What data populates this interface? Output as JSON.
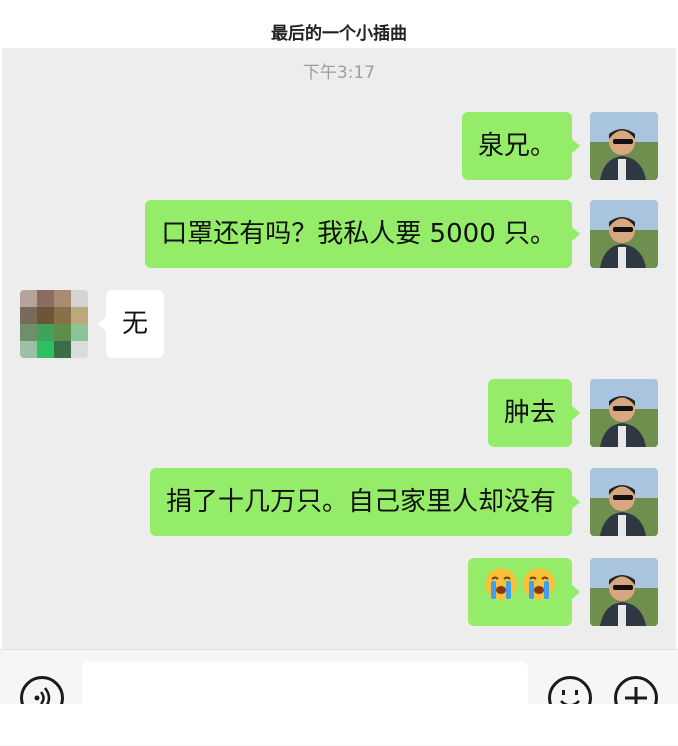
{
  "header": {
    "title": "最后的一个小插曲"
  },
  "chat": {
    "timestamp": "下午3:17",
    "messages": [
      {
        "side": "right",
        "text": "泉兄。"
      },
      {
        "side": "right",
        "text": "口罩还有吗？我私人要 5000 只。"
      },
      {
        "side": "left",
        "text": "无"
      },
      {
        "side": "right",
        "text": "肿去"
      },
      {
        "side": "right",
        "text": "捐了十几万只。自己家里人却没有"
      },
      {
        "side": "right",
        "emoji": [
          "crying-face",
          "crying-face"
        ]
      }
    ]
  },
  "input_bar": {
    "voice_icon": "voice-icon",
    "emoji_icon": "smiley-icon",
    "plus_icon": "plus-icon",
    "input_value": ""
  },
  "colors": {
    "chat_background": "#ededed",
    "sent_bubble": "#95ec69",
    "received_bubble": "#ffffff"
  }
}
